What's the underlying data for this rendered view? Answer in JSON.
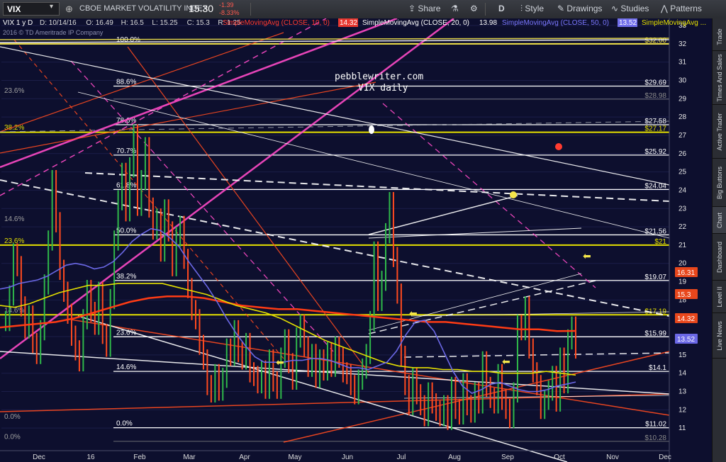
{
  "toolbar": {
    "symbol": "VIX",
    "security_name": "CBOE MARKET VOLATILITY INDEX",
    "last": "15.30",
    "change": "-1.39",
    "change_pct": "-8.33%",
    "period": "D",
    "share": "Share",
    "style": "Style",
    "drawings": "Drawings",
    "studies": "Studies",
    "patterns": "Patterns"
  },
  "side_tabs": [
    "Trade",
    "Times And Sales",
    "Active Trader",
    "Big Buttons",
    "Chart",
    "Dashboard",
    "Level II",
    "Live News"
  ],
  "chart_data": {
    "type": "line",
    "title": "VIX 1 y D",
    "header": {
      "date": "D: 10/14/16",
      "open": "O: 16.49",
      "high": "H: 16.5",
      "low": "L: 15.25",
      "close": "C: 15.3",
      "range": "R: 1.25"
    },
    "studies": [
      {
        "label": "SimpleMovingAvg (CLOSE, 10, 0)",
        "value": "14.32",
        "color": "#ff3b30"
      },
      {
        "label": "SimpleMovingAvg (CLOSE, 20, 0)",
        "value": "13.98",
        "color": "#ffffff"
      },
      {
        "label": "SimpleMovingAvg (CLOSE, 50, 0)",
        "value": "13.52",
        "color": "#7b78ff"
      },
      {
        "label": "SimpleMovingAvg ...",
        "value": "",
        "color": "#e5e000"
      }
    ],
    "copyright": "2016 © TD Ameritrade IP Company",
    "watermark": [
      "pebblewriter.com",
      "VIX daily"
    ],
    "ylim": [
      10,
      33
    ],
    "y_ticks": [
      11,
      12,
      13,
      14,
      15,
      16,
      17,
      18,
      19,
      20,
      21,
      22,
      23,
      24,
      25,
      26,
      27,
      28,
      29,
      30,
      31,
      32,
      33
    ],
    "x_ticks": [
      "Dec",
      "16",
      "Feb",
      "Mar",
      "Apr",
      "May",
      "Jun",
      "Jul",
      "Aug",
      "Sep",
      "Oct",
      "Nov",
      "Dec"
    ],
    "price_badges": [
      {
        "value": "16.31",
        "color": "#e8471c"
      },
      {
        "value": "15.3",
        "color": "#e8471c"
      },
      {
        "value": "14.32",
        "color": "#e8471c"
      },
      {
        "value": "13.52",
        "color": "#6b68e6"
      }
    ],
    "levels": [
      {
        "value": 32.0,
        "label": "$32.00",
        "color": "#f5e64a"
      },
      {
        "value": 29.69,
        "label": "$29.69",
        "color": "#ffffff"
      },
      {
        "value": 28.98,
        "label": "$28.98",
        "color": "#888888"
      },
      {
        "value": 27.58,
        "label": "$27.58",
        "color": "#ffffff"
      },
      {
        "value": 27.17,
        "label": "$27.17",
        "color": "#e5e000"
      },
      {
        "value": 25.92,
        "label": "$25.92",
        "color": "#ffffff"
      },
      {
        "value": 24.04,
        "label": "$24.04",
        "color": "#ffffff"
      },
      {
        "value": 21.56,
        "label": "$21.56",
        "color": "#ffffff"
      },
      {
        "value": 21.0,
        "label": "$21",
        "color": "#e5e000"
      },
      {
        "value": 19.07,
        "label": "$19.07",
        "color": "#ffffff"
      },
      {
        "value": 17.19,
        "label": "$17.19",
        "color": "#e5e000"
      },
      {
        "value": 15.99,
        "label": "$15.99",
        "color": "#ffffff"
      },
      {
        "value": 14.1,
        "label": "$14.1",
        "color": "#ffffff"
      },
      {
        "value": 11.02,
        "label": "$11.02",
        "color": "#ffffff"
      },
      {
        "value": 10.28,
        "label": "$10.28",
        "color": "#888888"
      }
    ],
    "fib_labels": [
      {
        "label": "100.0%",
        "value": 32.0
      },
      {
        "label": "88.6%",
        "value": 29.69
      },
      {
        "label": "78.6%",
        "value": 27.58
      },
      {
        "label": "70.7%",
        "value": 25.92
      },
      {
        "label": "61.8%",
        "value": 24.04
      },
      {
        "label": "50.0%",
        "value": 21.56
      },
      {
        "label": "38.2%",
        "value": 19.07
      },
      {
        "label": "23.6%",
        "value": 15.99
      },
      {
        "label": "14.6%",
        "value": 14.1
      },
      {
        "label": "0.0%",
        "value": 11.02
      }
    ],
    "fib_labels_left": [
      {
        "label": "23.6%",
        "value": 29.2
      },
      {
        "label": "38.2%",
        "value": 27.2
      },
      {
        "label": "14.6%",
        "value": 22.2
      },
      {
        "label": "23.6%",
        "value": 21.0
      },
      {
        "label": "14.6%",
        "value": 17.2
      },
      {
        "label": "0.0%",
        "value": 11.4
      },
      {
        "label": "0.0%",
        "value": 10.3
      }
    ],
    "price": [
      16.8,
      18.2,
      20.5,
      19.8,
      17.6,
      16.4,
      17.1,
      15.6,
      15.0,
      16.3,
      18.8,
      21.2,
      24.5,
      22.2,
      19.6,
      18.4,
      17.2,
      16.0,
      15.2,
      14.6,
      16.9,
      18.5,
      17.3,
      16.6,
      18.4,
      16.1,
      15.4,
      18.0,
      21.2,
      23.4,
      24.9,
      22.8,
      25.2,
      27.0,
      23.1,
      24.5,
      26.3,
      23.0,
      21.8,
      22.4,
      20.6,
      22.9,
      21.7,
      19.8,
      21.4,
      22.0,
      20.2,
      18.6,
      17.4,
      16.9,
      15.5,
      14.7,
      13.3,
      12.9,
      13.9,
      13.0,
      13.7,
      15.3,
      14.9,
      16.3,
      15.1,
      14.7,
      15.6,
      14.0,
      13.8,
      13.4,
      14.1,
      13.1,
      14.7,
      13.5,
      13.1,
      14.8,
      15.8,
      14.5,
      13.6,
      15.9,
      16.6,
      15.4,
      14.3,
      15.0,
      13.7,
      14.7,
      14.1,
      15.1,
      14.3,
      15.4,
      14.8,
      14.0,
      13.9,
      13.3,
      12.8,
      13.6,
      14.2,
      15.0,
      16.8,
      20.6,
      17.9,
      19.0,
      21.6,
      23.3,
      20.3,
      18.3,
      14.9,
      13.3,
      12.2,
      13.7,
      12.8,
      12.2,
      11.6,
      12.9,
      12.3,
      11.9,
      11.6,
      12.2,
      11.4,
      13.2,
      12.0,
      11.7,
      13.4,
      12.2,
      11.8,
      12.9,
      12.3,
      14.6,
      13.2,
      12.6,
      12.3,
      13.9,
      12.5,
      12.0,
      11.5,
      12.9,
      16.6,
      16.3,
      17.6,
      15.3,
      14.0,
      13.3,
      12.0,
      12.5,
      13.0,
      13.8,
      12.4,
      14.8,
      13.4,
      15.8,
      16.5,
      15.3
    ],
    "sma50": [
      18.6,
      18.7,
      18.9,
      19.0,
      19.1,
      19.3,
      19.6,
      19.9,
      20.0,
      19.9,
      19.7,
      19.8,
      20.1,
      20.6,
      21.2,
      21.6,
      21.9,
      21.8,
      21.4,
      20.9,
      20.1,
      19.4,
      18.7,
      17.9,
      17.0,
      16.2,
      15.5,
      14.9,
      14.6,
      14.6,
      14.6,
      14.7,
      14.7,
      14.8,
      14.8,
      14.7,
      14.5,
      14.3,
      14.3,
      14.2,
      14.4,
      14.6,
      15.2,
      16.1,
      16.8,
      16.9,
      16.3,
      15.2,
      14.1,
      13.3,
      12.9,
      13.1,
      13.4,
      13.5,
      13.3,
      13.1,
      13.0,
      13.0,
      13.1,
      13.3,
      13.4,
      13.52
    ],
    "sma_yellow": [
      17.7,
      17.6,
      17.8,
      18.1,
      18.4,
      18.6,
      18.8,
      18.8,
      18.9,
      18.9,
      18.9,
      18.9,
      18.7,
      18.5,
      18.3,
      18.0,
      17.7,
      17.5,
      17.3,
      17.0,
      16.6,
      16.2,
      15.8,
      15.5,
      15.2,
      14.9,
      14.6,
      14.4,
      14.3,
      14.3,
      14.2,
      14.2,
      14.1,
      14.1,
      14.0,
      14.0,
      14.0,
      14.1,
      14.0,
      13.9
    ],
    "sma_red": [
      16.5,
      16.6,
      16.7,
      16.8,
      17.0,
      17.3,
      17.6,
      17.9,
      18.1,
      18.2,
      18.2,
      18.1,
      17.9,
      17.7,
      17.6,
      17.5,
      17.5,
      17.4,
      17.3,
      17.2,
      17.1,
      17.0,
      16.9,
      16.8,
      16.8,
      16.7,
      16.6,
      16.5,
      16.4,
      16.4,
      16.3,
      16.31
    ]
  }
}
